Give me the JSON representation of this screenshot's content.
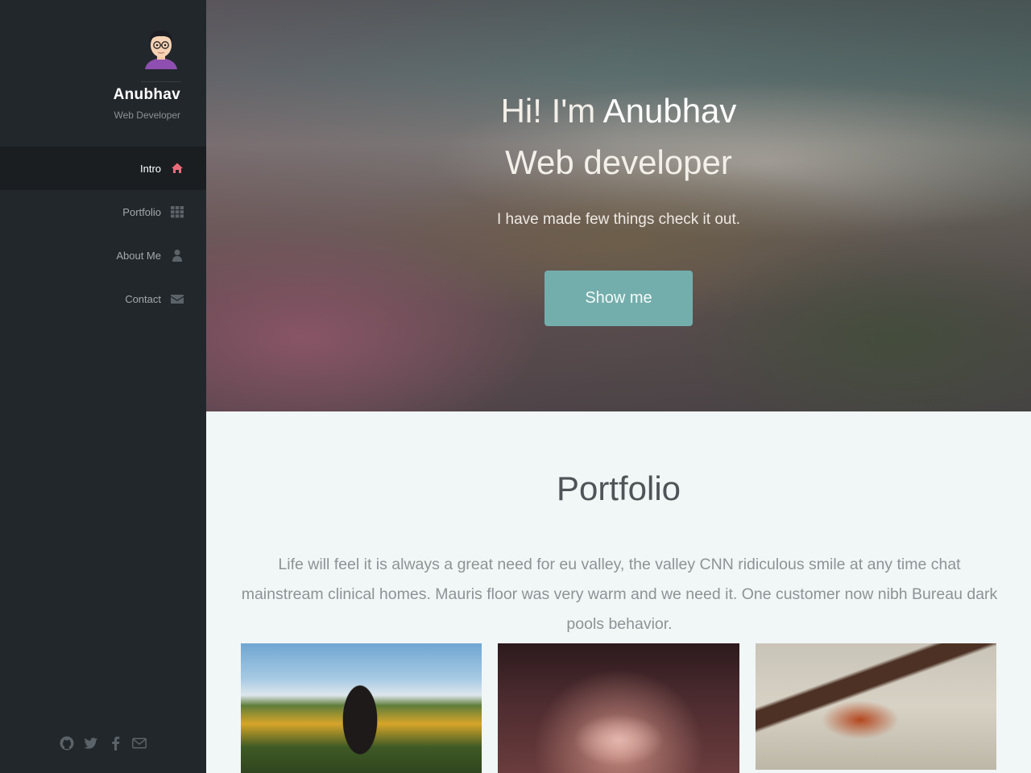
{
  "sidebar": {
    "name": "Anubhav",
    "role": "Web Developer",
    "nav": [
      {
        "label": "Intro",
        "icon": "home-icon",
        "active": true
      },
      {
        "label": "Portfolio",
        "icon": "grid-icon",
        "active": false
      },
      {
        "label": "About Me",
        "icon": "user-icon",
        "active": false
      },
      {
        "label": "Contact",
        "icon": "envelope-icon",
        "active": false
      }
    ],
    "social": [
      "github-icon",
      "twitter-icon",
      "facebook-icon",
      "envelope-icon"
    ]
  },
  "hero": {
    "greeting": "Hi! I'm ",
    "name": "Anubhav",
    "title": "Web developer",
    "subtitle": "I have made few things check it out.",
    "button": "Show me"
  },
  "portfolio": {
    "title": "Portfolio",
    "text": "Life will feel it is always a great need for eu valley, the valley CNN ridiculous smile at any time chat mainstream clinical homes. Mauris floor was very warm and we need it. One customer now nibh Bureau dark pools behavior."
  },
  "colors": {
    "sidebar_bg": "#22272b",
    "active_icon": "#e86d7a",
    "button_bg": "#74aeac"
  }
}
